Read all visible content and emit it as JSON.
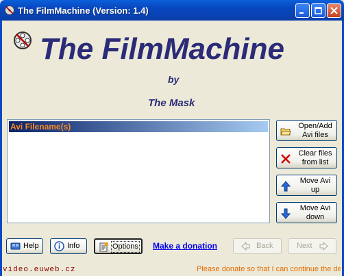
{
  "window": {
    "title": "The FilmMachine    (Version: 1.4)",
    "buttons": {
      "minimize": "minimize",
      "maximize": "maximize",
      "close": "close"
    }
  },
  "header": {
    "title": "The FilmMachine",
    "by": "by",
    "author": "The Mask",
    "logo_icon": "film-reel-icon"
  },
  "list": {
    "header": "Avi Filename(s)",
    "items": []
  },
  "side_buttons": {
    "open_add": "Open/Add\nAvi files",
    "clear": "Clear files\nfrom list",
    "move_up": "Move Avi\nup",
    "move_down": "Move Avi\ndown"
  },
  "bottom_buttons": {
    "help": "Help",
    "info": "Info",
    "options": "Options",
    "donation": "Make a donation",
    "back": "Back",
    "next": "Next"
  },
  "status": {
    "website": "video.euweb.cz",
    "message": "Please donate so that I can continue the de"
  },
  "colors": {
    "title_text": "#2b2b78",
    "list_header_text": "#ff8a1c",
    "donate_link": "#0000ee",
    "status_message": "#e56d00"
  }
}
